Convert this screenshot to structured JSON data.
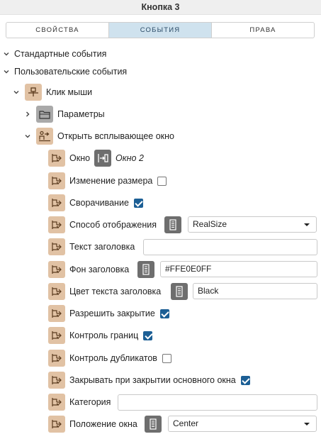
{
  "window": {
    "title": "Кнопка 3"
  },
  "tabs": [
    {
      "label": "СВОЙСТВА",
      "active": false
    },
    {
      "label": "СОБЫТИЯ",
      "active": true
    },
    {
      "label": "ПРАВА",
      "active": false
    }
  ],
  "tree": {
    "standard_events": "Стандартные события",
    "custom_events": "Пользовательские события",
    "mouse_click": "Клик мыши",
    "parameters": "Параметры",
    "open_popup": "Открыть всплывающее окно"
  },
  "properties": {
    "window": {
      "label": "Окно",
      "value": "Окно 2"
    },
    "resize": {
      "label": "Изменение размера",
      "checked": false
    },
    "minimize": {
      "label": "Сворачивание",
      "checked": true
    },
    "display_mode": {
      "label": "Способ отображения",
      "value": "RealSize"
    },
    "title_text": {
      "label": "Текст заголовка",
      "value": ""
    },
    "title_bg": {
      "label": "Фон заголовка",
      "value": "#FFE0E0FF"
    },
    "title_color": {
      "label": "Цвет текста заголовка",
      "value": "Black"
    },
    "allow_close": {
      "label": "Разрешить закрытие",
      "checked": true
    },
    "bounds_control": {
      "label": "Контроль границ",
      "checked": true
    },
    "duplicates_control": {
      "label": "Контроль дубликатов",
      "checked": false
    },
    "close_with_main": {
      "label": "Закрывать при закрытии основного окна",
      "checked": true
    },
    "category": {
      "label": "Категория",
      "value": ""
    },
    "window_position": {
      "label": "Положение окна",
      "value": "Center"
    }
  },
  "colors": {
    "accent": "#1c5f95",
    "active_tab": "#cfe2ee",
    "action_icon": "#e1c2a4",
    "bind_icon": "#6e6e6e"
  },
  "icons": {
    "expand": "chevron-down-icon",
    "collapsed": "chevron-right-icon",
    "event": "event-node-icon",
    "parameters": "folder-icon",
    "action": "open-popup-icon",
    "property": "property-arrows-icon",
    "binding": "binding-icon",
    "window_ref": "window-ref-icon"
  }
}
